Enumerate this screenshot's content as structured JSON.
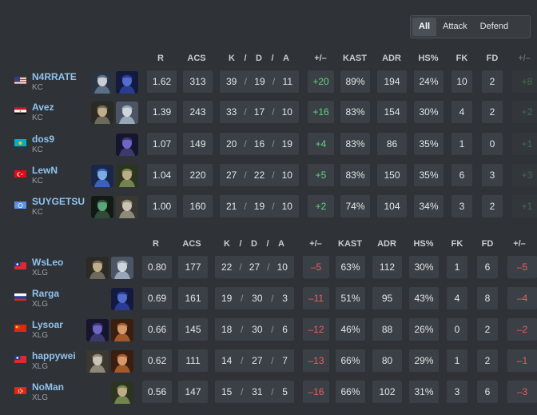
{
  "filter": {
    "options": [
      "All",
      "Attack",
      "Defend"
    ],
    "active": "All"
  },
  "columns": [
    "R",
    "ACS",
    "K",
    "/",
    "D",
    "/",
    "A",
    "+/–",
    "KAST",
    "ADR",
    "HS%",
    "FK",
    "FD",
    "+/–"
  ],
  "teams": [
    {
      "players": [
        {
          "name": "N4RRATE",
          "team": "KC",
          "flag": "us",
          "agents": [
            "jett",
            "yoru"
          ],
          "r": "1.62",
          "acs": "313",
          "k": "39",
          "d": "19",
          "a": "11",
          "pm": "+20",
          "kast": "89%",
          "adr": "194",
          "hs": "24%",
          "fk": "10",
          "fd": "2",
          "fpm": "+8"
        },
        {
          "name": "Avez",
          "team": "KC",
          "flag": "eg",
          "agents": [
            "chamber",
            "sova"
          ],
          "r": "1.39",
          "acs": "243",
          "k": "33",
          "d": "17",
          "a": "10",
          "pm": "+16",
          "kast": "83%",
          "adr": "154",
          "hs": "30%",
          "fk": "4",
          "fd": "2",
          "fpm": "+2"
        },
        {
          "name": "dos9",
          "team": "KC",
          "flag": "kz",
          "agents": [
            "omen"
          ],
          "r": "1.07",
          "acs": "149",
          "k": "20",
          "d": "16",
          "a": "19",
          "pm": "+4",
          "kast": "83%",
          "adr": "86",
          "hs": "35%",
          "fk": "1",
          "fd": "0",
          "fpm": "+1"
        },
        {
          "name": "LewN",
          "team": "KC",
          "flag": "tr",
          "agents": [
            "neon",
            "skye"
          ],
          "r": "1.04",
          "acs": "220",
          "k": "27",
          "d": "22",
          "a": "10",
          "pm": "+5",
          "kast": "83%",
          "adr": "150",
          "hs": "35%",
          "fk": "6",
          "fd": "3",
          "fpm": "+3"
        },
        {
          "name": "SUYGETSU",
          "team": "KC",
          "flag": "un",
          "agents": [
            "viper",
            "cypher"
          ],
          "r": "1.00",
          "acs": "160",
          "k": "21",
          "d": "19",
          "a": "10",
          "pm": "+2",
          "kast": "74%",
          "adr": "104",
          "hs": "34%",
          "fk": "3",
          "fd": "2",
          "fpm": "+1"
        }
      ]
    },
    {
      "players": [
        {
          "name": "WsLeo",
          "team": "XLG",
          "flag": "tw",
          "agents": [
            "chamber",
            "sova"
          ],
          "r": "0.80",
          "acs": "177",
          "k": "22",
          "d": "27",
          "a": "10",
          "pm": "-5",
          "kast": "63%",
          "adr": "112",
          "hs": "30%",
          "fk": "1",
          "fd": "6",
          "fpm": "-5"
        },
        {
          "name": "Rarga",
          "team": "XLG",
          "flag": "ru",
          "agents": [
            "yoru"
          ],
          "r": "0.69",
          "acs": "161",
          "k": "19",
          "d": "30",
          "a": "3",
          "pm": "-11",
          "kast": "51%",
          "adr": "95",
          "hs": "43%",
          "fk": "4",
          "fd": "8",
          "fpm": "-4"
        },
        {
          "name": "Lysoar",
          "team": "XLG",
          "flag": "cn",
          "agents": [
            "omen",
            "phoenix"
          ],
          "r": "0.66",
          "acs": "145",
          "k": "18",
          "d": "30",
          "a": "6",
          "pm": "-12",
          "kast": "46%",
          "adr": "88",
          "hs": "26%",
          "fk": "0",
          "fd": "2",
          "fpm": "-2"
        },
        {
          "name": "happywei",
          "team": "XLG",
          "flag": "tw",
          "agents": [
            "cypher",
            "phoenix"
          ],
          "r": "0.62",
          "acs": "111",
          "k": "14",
          "d": "27",
          "a": "7",
          "pm": "-13",
          "kast": "66%",
          "adr": "80",
          "hs": "29%",
          "fk": "1",
          "fd": "2",
          "fpm": "-1"
        },
        {
          "name": "NoMan",
          "team": "XLG",
          "flag": "hk",
          "agents": [
            "skye"
          ],
          "r": "0.56",
          "acs": "147",
          "k": "15",
          "d": "31",
          "a": "5",
          "pm": "-16",
          "kast": "66%",
          "adr": "102",
          "hs": "31%",
          "fk": "3",
          "fd": "6",
          "fpm": "-3"
        }
      ]
    }
  ],
  "colors": {
    "background": "#2f3337",
    "cell": "#3b4046",
    "player_name": "#8fc3ef",
    "positive": "#5fd37c",
    "negative": "#ef5c5c"
  }
}
